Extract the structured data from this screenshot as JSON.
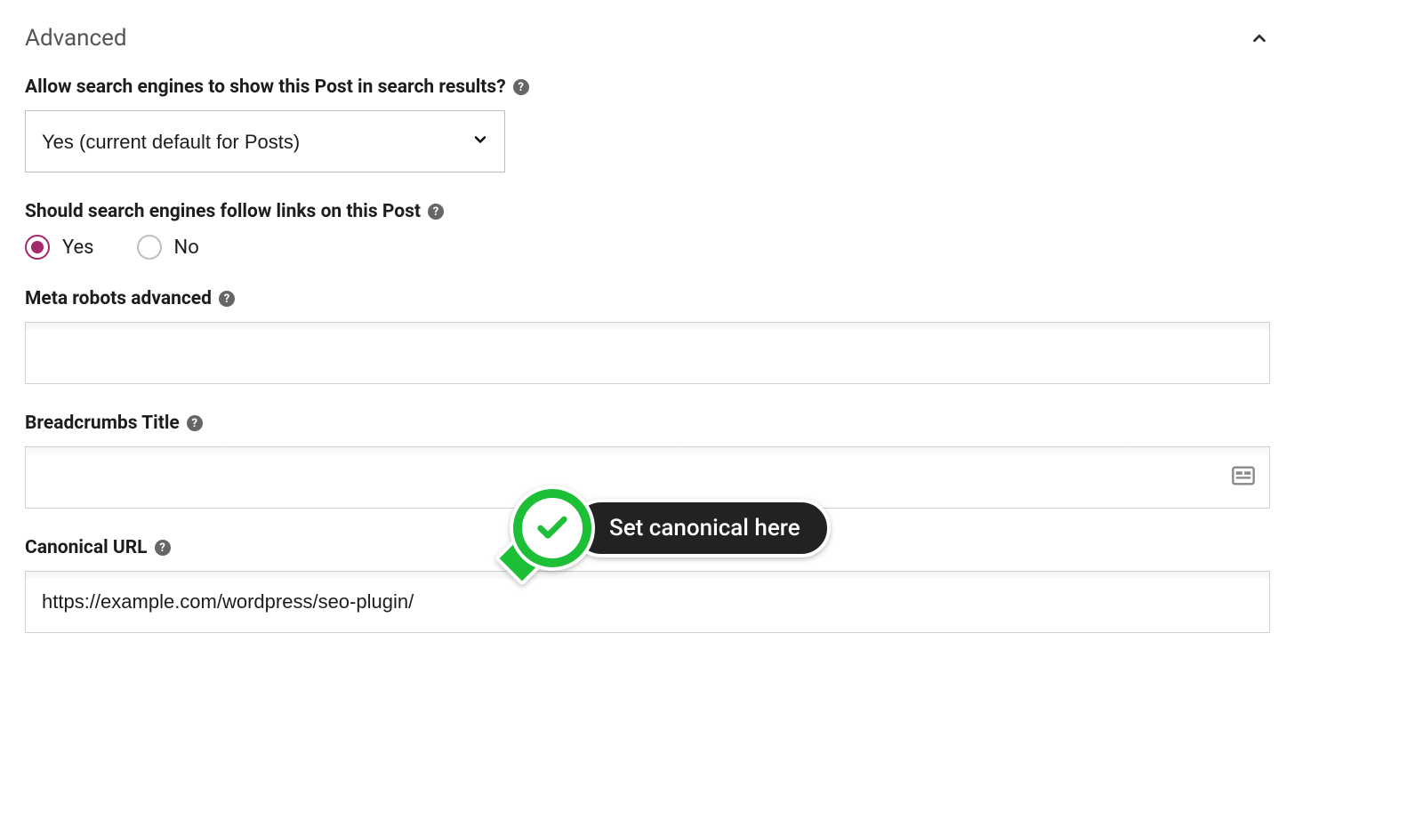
{
  "panel": {
    "title": "Advanced"
  },
  "fields": {
    "allow_search": {
      "label": "Allow search engines to show this Post in search results?",
      "value": "Yes (current default for Posts)"
    },
    "follow_links": {
      "label": "Should search engines follow links on this Post",
      "options": {
        "yes": "Yes",
        "no": "No"
      },
      "selected": "yes"
    },
    "meta_robots": {
      "label": "Meta robots advanced",
      "value": ""
    },
    "breadcrumbs": {
      "label": "Breadcrumbs Title",
      "value": ""
    },
    "canonical": {
      "label": "Canonical URL",
      "value": "https://example.com/wordpress/seo-plugin/"
    }
  },
  "annotation": {
    "text": "Set canonical here"
  },
  "colors": {
    "accent": "#a4286a",
    "annotation_green": "#1dbf36"
  }
}
